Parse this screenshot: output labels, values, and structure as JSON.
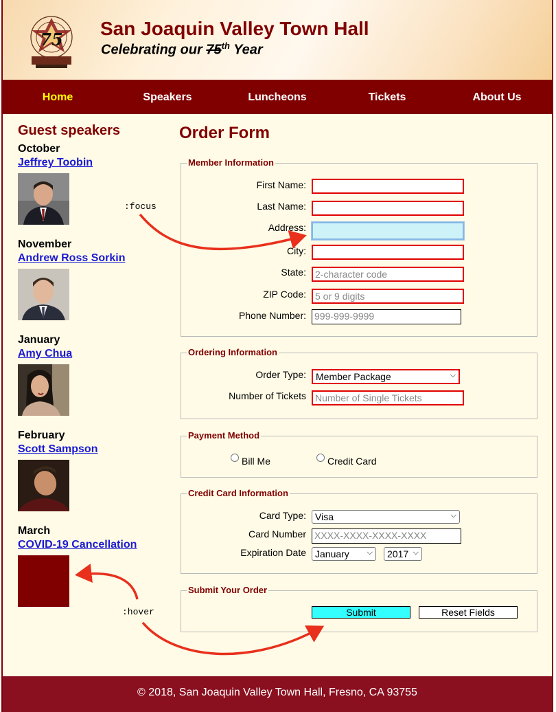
{
  "header": {
    "title": "San Joaquin Valley Town Hall",
    "tagline_pre": "Celebrating our ",
    "tagline_num": "75",
    "tagline_sup": "th",
    "tagline_post": " Year"
  },
  "nav": [
    "Home",
    "Speakers",
    "Luncheons",
    "Tickets",
    "About Us"
  ],
  "sidebar": {
    "title": "Guest speakers",
    "speakers": [
      {
        "month": "October",
        "name": "Jeffrey Toobin"
      },
      {
        "month": "November",
        "name": "Andrew Ross Sorkin"
      },
      {
        "month": "January",
        "name": "Amy Chua"
      },
      {
        "month": "February",
        "name": "Scott Sampson"
      },
      {
        "month": "March",
        "name": "COVID-19 Cancellation"
      }
    ]
  },
  "annotations": {
    "focus": ":focus",
    "hover": ":hover"
  },
  "form": {
    "title": "Order Form",
    "member": {
      "legend": "Member Information",
      "first_name": "First Name:",
      "last_name": "Last Name:",
      "address": "Address:",
      "city": "City:",
      "state": "State:",
      "state_ph": "2-character code",
      "zip": "ZIP Code:",
      "zip_ph": "5 or 9 digits",
      "phone": "Phone Number:",
      "phone_ph": "999-999-9999"
    },
    "ordering": {
      "legend": "Ordering Information",
      "order_type": "Order Type:",
      "order_type_value": "Member Package",
      "tickets": "Number of Tickets",
      "tickets_ph": "Number of Single Tickets"
    },
    "payment": {
      "legend": "Payment Method",
      "bill_me": "Bill Me",
      "credit_card": "Credit Card"
    },
    "card": {
      "legend": "Credit Card Information",
      "card_type": "Card Type:",
      "card_type_value": "Visa",
      "card_number": "Card Number",
      "card_number_ph": "XXXX-XXXX-XXXX-XXXX",
      "expiration": "Expiration Date",
      "month_value": "January",
      "year_value": "2017"
    },
    "submit": {
      "legend": "Submit Your Order",
      "submit_label": "Submit",
      "reset_label": "Reset Fields"
    }
  },
  "footer": {
    "text": "© 2018, San Joaquin Valley Town Hall, Fresno, CA 93755"
  },
  "colors": {
    "brand": "#800000",
    "background": "#fffbe7",
    "error_border": "#e00000",
    "focus_bg": "#cdf3f9",
    "submit_hover": "#33ffff",
    "link": "#1a1ad2",
    "annotation_arrow": "#e8301c"
  }
}
